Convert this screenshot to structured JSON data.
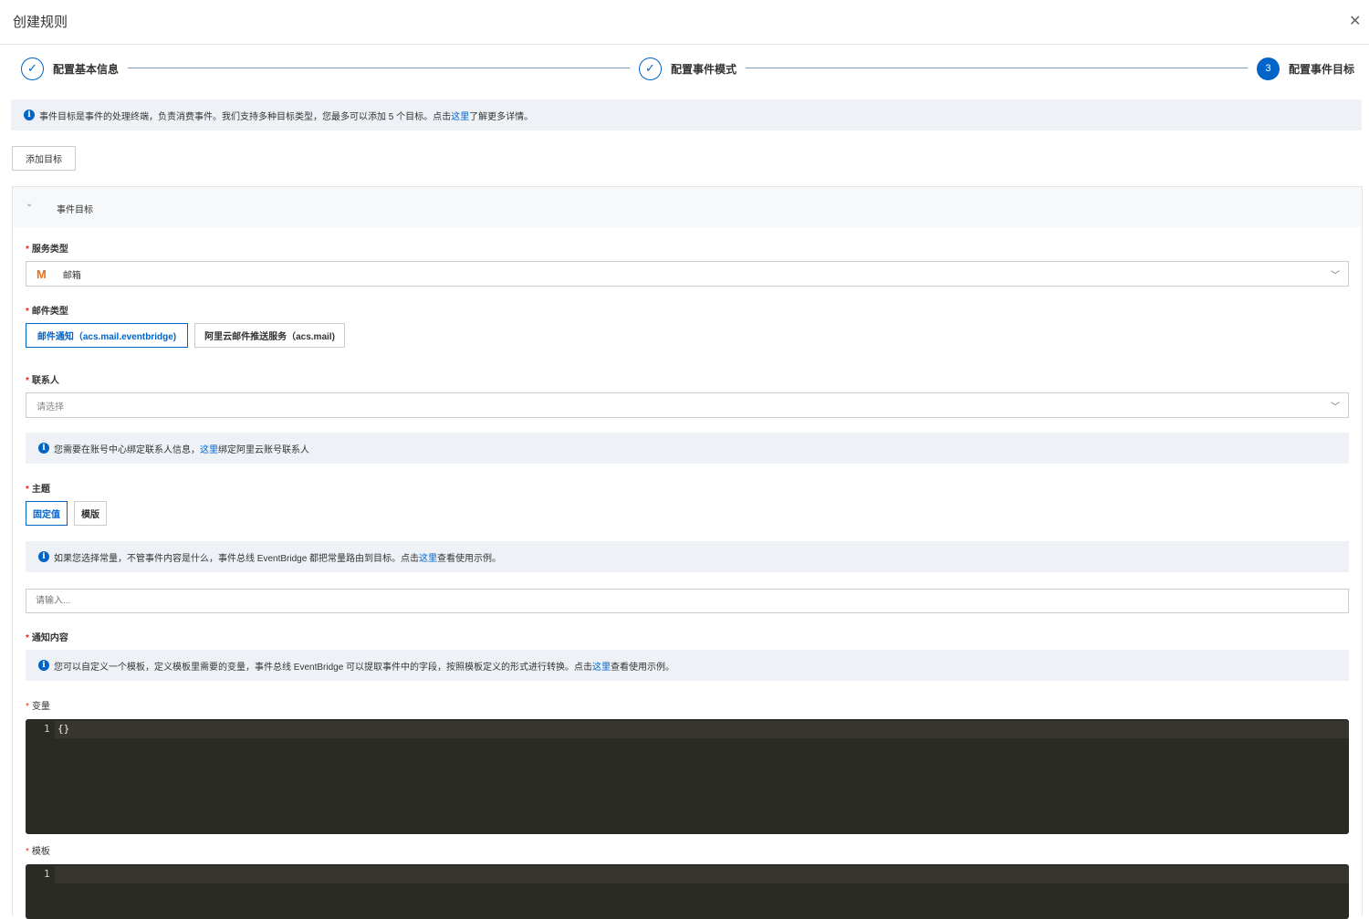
{
  "header": {
    "title": "创建规则",
    "close_icon": "close-icon"
  },
  "steps": [
    {
      "label": "配置基本信息",
      "state": "done",
      "marker": "✓"
    },
    {
      "label": "配置事件模式",
      "state": "done",
      "marker": "✓"
    },
    {
      "label": "配置事件目标",
      "state": "active",
      "marker": "3"
    }
  ],
  "intro": {
    "text": "事件目标是事件的处理终端，负责消费事件。我们支持多种目标类型，您最多可以添加 5 个目标。点击",
    "link": "这里",
    "suffix": "了解更多详情。"
  },
  "add_target_label": "添加目标",
  "panel": {
    "title": "事件目标",
    "service_type": {
      "label": "服务类型",
      "value": "邮箱",
      "icon": "M"
    },
    "mail_type": {
      "label": "邮件类型",
      "options": [
        "邮件通知（acs.mail.eventbridge)",
        "阿里云邮件推送服务（acs.mail)"
      ],
      "selected": 0
    },
    "contact": {
      "label": "联系人",
      "placeholder": "请选择",
      "info_text": "您需要在账号中心绑定联系人信息，",
      "info_link": "这里",
      "info_suffix": "绑定阿里云账号联系人"
    },
    "subject": {
      "label": "主题",
      "options": [
        "固定值",
        "模版"
      ],
      "selected": 0,
      "info_text": "如果您选择常量，不管事件内容是什么，事件总线 EventBridge 都把常量路由到目标。点击",
      "info_link": "这里",
      "info_suffix": "查看使用示例。",
      "placeholder": "请输入..."
    },
    "content": {
      "label": "通知内容",
      "info_text": "您可以自定义一个模板，定义模板里需要的变量，事件总线 EventBridge 可以提取事件中的字段，按照模板定义的形式进行转换。点击",
      "info_link": "这里",
      "info_suffix": "查看使用示例。"
    },
    "variables": {
      "label": "变量",
      "line": "1",
      "code": "{}"
    },
    "template": {
      "label": "模板",
      "line": "1",
      "code": ""
    }
  }
}
